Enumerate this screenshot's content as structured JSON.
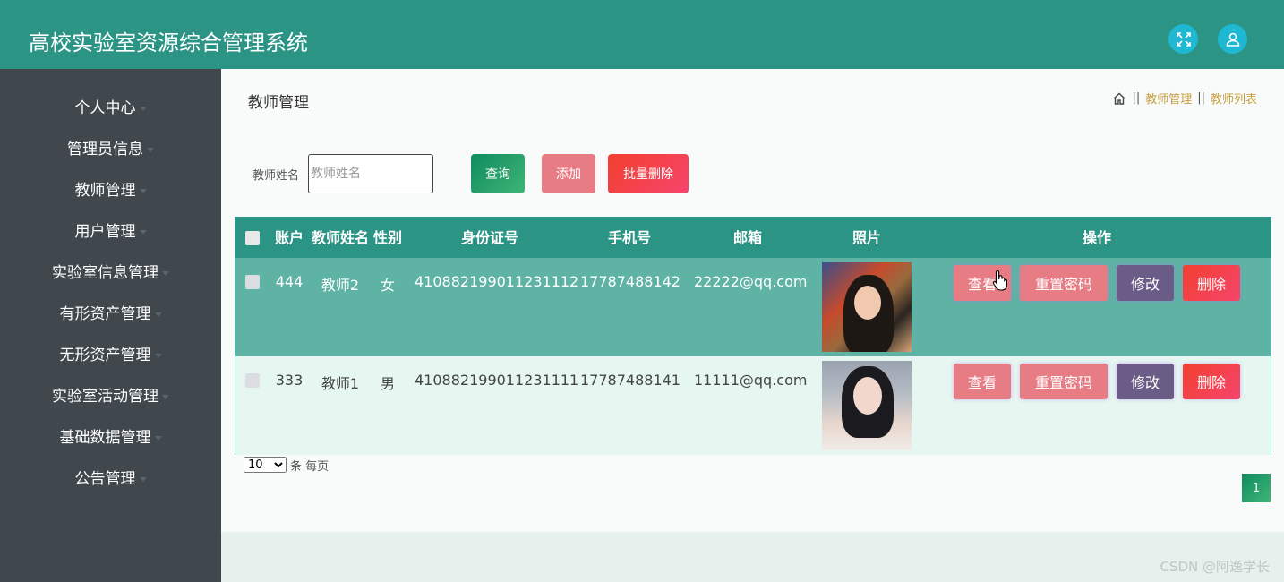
{
  "header": {
    "app_title": "高校实验室资源综合管理系统",
    "fullscreen_icon": "expand-icon",
    "user_icon": "user-icon"
  },
  "sidebar": {
    "items": [
      {
        "label": "个人中心"
      },
      {
        "label": "管理员信息"
      },
      {
        "label": "教师管理"
      },
      {
        "label": "用户管理"
      },
      {
        "label": "实验室信息管理"
      },
      {
        "label": "有形资产管理"
      },
      {
        "label": "无形资产管理"
      },
      {
        "label": "实验室活动管理"
      },
      {
        "label": "基础数据管理"
      },
      {
        "label": "公告管理"
      }
    ]
  },
  "main": {
    "page_title": "教师管理",
    "breadcrumb": {
      "home_icon": "home-icon",
      "separator": "||",
      "items": [
        "教师管理",
        "教师列表"
      ]
    },
    "search": {
      "label": "教师姓名",
      "placeholder": "教师姓名",
      "value": "",
      "query_button": "查询",
      "add_button": "添加",
      "batch_delete_button": "批量删除"
    },
    "table": {
      "columns": [
        "账户",
        "教师姓名",
        "性别",
        "身份证号",
        "手机号",
        "邮箱",
        "照片",
        "操作"
      ],
      "rows": [
        {
          "account": "444",
          "name": "教师2",
          "gender": "女",
          "id_number": "410882199011231112",
          "phone": "17787488142",
          "email": "22222@qq.com",
          "photo": "portrait-photo"
        },
        {
          "account": "333",
          "name": "教师1",
          "gender": "男",
          "id_number": "410882199011231111",
          "phone": "17787488141",
          "email": "11111@qq.com",
          "photo": "portrait-photo"
        }
      ],
      "actions": {
        "view": "查看",
        "reset_password": "重置密码",
        "edit": "修改",
        "delete": "删除"
      }
    },
    "pagination": {
      "page_size": "10",
      "page_size_suffix": "条 每页",
      "current_page": "1"
    }
  },
  "watermark": "CSDN @阿逸学长",
  "colors": {
    "header": "#2b9485",
    "sidebar": "#40474d",
    "row_highlight": "#5fb3a4",
    "accent_pink": "#e87c84",
    "accent_purple": "#6b5b87",
    "accent_red": "#f33f2f"
  }
}
